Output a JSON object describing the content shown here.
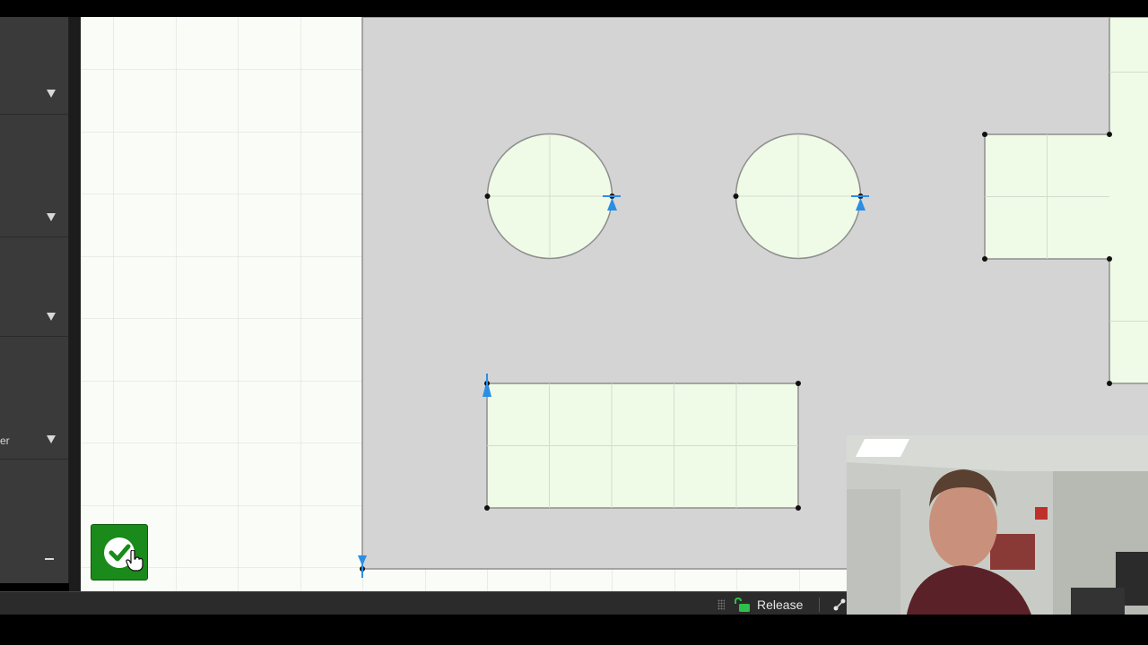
{
  "sidebar": {
    "sections": [
      {
        "label": ""
      },
      {
        "label": ""
      },
      {
        "label": ""
      },
      {
        "label": "er"
      },
      {
        "label": ""
      }
    ]
  },
  "status_bar": {
    "release_label": "Release"
  },
  "icons": {
    "confirm": "check-circle-icon",
    "cursor": "hand-pointer-icon",
    "release": "padlock-open-icon",
    "expand": "triangle-down-icon",
    "collapse": "minus-icon"
  },
  "colors": {
    "canvas_background": "#fafdf7",
    "sheet_gray": "#d4d4d4",
    "shape_fill": "#effbe6",
    "shape_outline": "#8e8e8e",
    "vertex": "#111111",
    "start_marker": "#2a8ee6",
    "confirm_green": "#1a8a1a",
    "sidebar": "#3a3a3a"
  }
}
